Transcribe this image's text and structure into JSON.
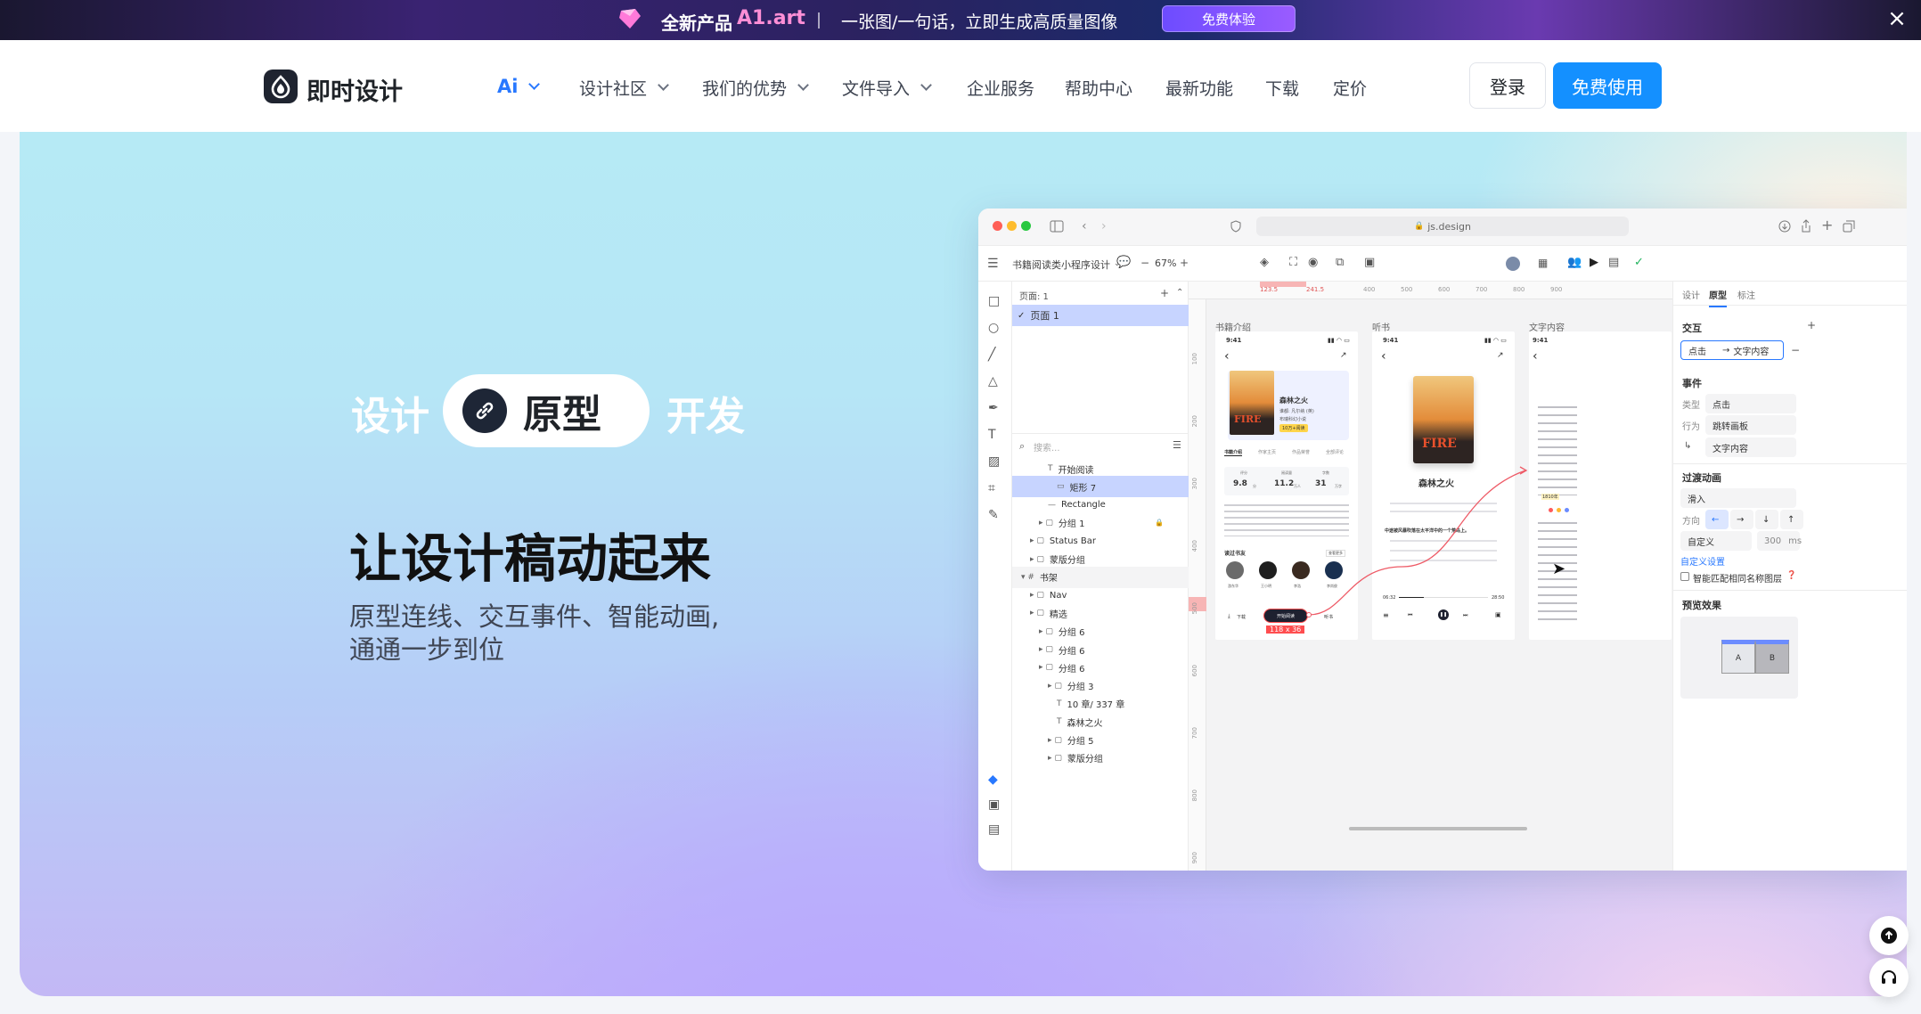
{
  "banner": {
    "new_product": "全新产品",
    "brand": "A1.art",
    "slogan": "一张图/一句话，立即生成高质量图像",
    "cta": "免费体验",
    "close": "×"
  },
  "nav": {
    "logo": "即时设计",
    "items": [
      {
        "label": "Ai",
        "dropdown": true,
        "active": true
      },
      {
        "label": "设计社区",
        "dropdown": true
      },
      {
        "label": "我们的优势",
        "dropdown": true
      },
      {
        "label": "文件导入",
        "dropdown": true
      },
      {
        "label": "企业服务",
        "dropdown": false
      },
      {
        "label": "帮助中心",
        "dropdown": false
      },
      {
        "label": "最新功能",
        "dropdown": false
      },
      {
        "label": "下载",
        "dropdown": false
      },
      {
        "label": "定价",
        "dropdown": false
      }
    ],
    "login": "登录",
    "free": "免费使用"
  },
  "hero": {
    "kw_left": "设计",
    "kw_mid": "原型",
    "kw_right": "开发",
    "title": "让设计稿动起来",
    "desc": "原型连线、交互事件、智能动画,通通一步到位"
  },
  "app": {
    "url": "js.design",
    "file_name": "书籍阅读类小程序设计",
    "zoom": "67%",
    "pages_label": "页面: 1",
    "page1": "页面 1",
    "search_placeholder": "搜索...",
    "layers": [
      {
        "label": "开始阅读",
        "type": "T",
        "indent": 4
      },
      {
        "label": "矩形 7",
        "type": "rect",
        "indent": 5,
        "selected": true
      },
      {
        "label": "Rectangle",
        "type": "line",
        "indent": 4
      },
      {
        "label": "分组 1",
        "type": "group",
        "indent": 3,
        "locked": true
      },
      {
        "label": "Status Bar",
        "type": "group",
        "indent": 2
      },
      {
        "label": "蒙版分组",
        "type": "group",
        "indent": 2
      },
      {
        "label": "书架",
        "type": "frame",
        "indent": 1,
        "header": true
      },
      {
        "label": "Nav",
        "type": "group",
        "indent": 2
      },
      {
        "label": "精选",
        "type": "group",
        "indent": 2
      },
      {
        "label": "分组 6",
        "type": "group",
        "indent": 3
      },
      {
        "label": "分组 6",
        "type": "group",
        "indent": 3
      },
      {
        "label": "分组 6",
        "type": "group",
        "indent": 3
      },
      {
        "label": "分组 3",
        "type": "group",
        "indent": 4
      },
      {
        "label": "10 章/ 337 章",
        "type": "T",
        "indent": 5
      },
      {
        "label": "森林之火",
        "type": "T",
        "indent": 5
      },
      {
        "label": "分组 5",
        "type": "group",
        "indent": 4
      },
      {
        "label": "蒙版分组",
        "type": "group",
        "indent": 4
      }
    ],
    "ruler_marks": [
      "123.5",
      "241.5",
      "400",
      "500",
      "600",
      "700",
      "800",
      "900"
    ],
    "ruler_left_marks": [
      "100",
      "200",
      "300",
      "400",
      "500",
      "600",
      "700",
      "800",
      "900"
    ],
    "frames": [
      "书籍介绍",
      "听书",
      "文字内容"
    ],
    "phone1": {
      "time": "9:41",
      "book": "森林之火",
      "author": "谁都: 凡尔纳 (英)",
      "meta": "布瑞科幻小说",
      "tag": "10万+阅读",
      "tabs": [
        "书籍介绍",
        "作家主页",
        "作品荣誉",
        "全部评论"
      ],
      "stats": [
        {
          "k": "评分",
          "v": "9.8",
          "u": "分"
        },
        {
          "k": "阅读量",
          "v": "11.2",
          "u": "万人"
        },
        {
          "k": "字数",
          "v": "31",
          "u": "万字"
        }
      ],
      "readers_label": "读过书友",
      "more": "查看更多",
      "readers": [
        "游东华",
        "王小明",
        "李浩",
        "李尚俊"
      ],
      "download": "下载",
      "start": "开始阅读",
      "listen": "听书",
      "size": "118 x 36"
    },
    "phone2": {
      "time": "9:41",
      "title": "森林之火",
      "current": "中途被风暴吹落在太平洋中的一个荒岛上。",
      "elapsed": "06:32",
      "total": "28:50"
    },
    "phone3": {
      "time": "9:41",
      "highlight": "1810年"
    },
    "panel": {
      "tabs": [
        "设计",
        "原型",
        "标注"
      ],
      "interaction": "交互",
      "trigger": "点击",
      "target": "文字内容",
      "event": "事件",
      "type_k": "类型",
      "type_v": "点击",
      "action_k": "行为",
      "action_v": "跳转画板",
      "dest_v": "文字内容",
      "anim": "过渡动画",
      "anim_v": "滑入",
      "dir_k": "方向",
      "easing": "自定义",
      "duration": "300",
      "unit": "ms",
      "custom": "自定义设置",
      "smart": "智能匹配相同名称图层",
      "preview": "预览效果",
      "a": "A",
      "b": "B"
    }
  }
}
